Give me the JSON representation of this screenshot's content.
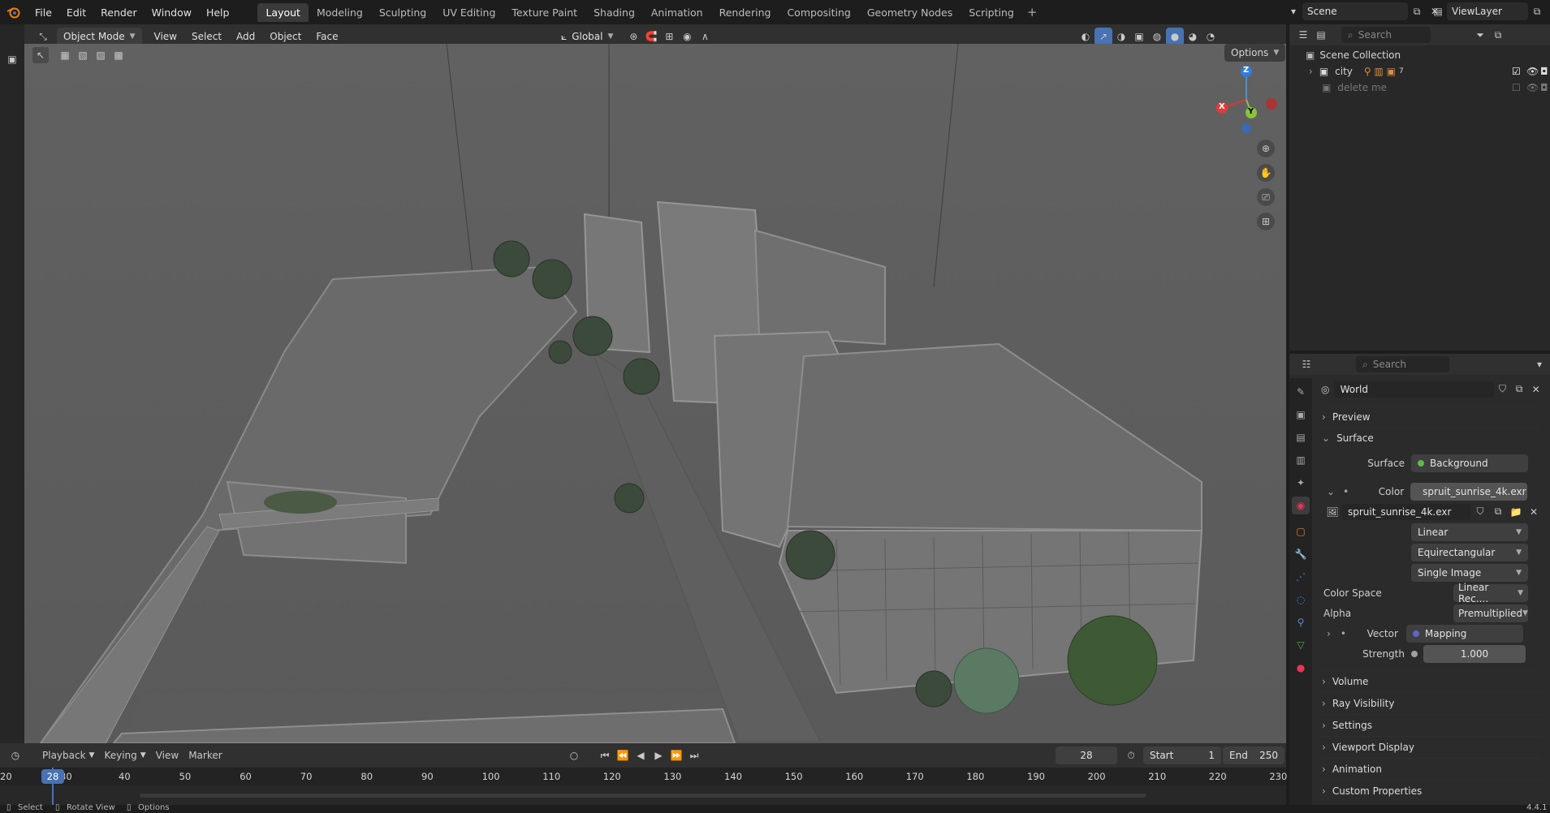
{
  "menubar": {
    "items": [
      "File",
      "Edit",
      "Render",
      "Window",
      "Help"
    ]
  },
  "workspace_tabs": [
    {
      "label": "Layout",
      "active": true
    },
    {
      "label": "Modeling"
    },
    {
      "label": "Sculpting"
    },
    {
      "label": "UV Editing"
    },
    {
      "label": "Texture Paint"
    },
    {
      "label": "Shading"
    },
    {
      "label": "Animation"
    },
    {
      "label": "Rendering"
    },
    {
      "label": "Compositing"
    },
    {
      "label": "Geometry Nodes"
    },
    {
      "label": "Scripting"
    }
  ],
  "add_tab": "+",
  "scene": {
    "name": "Scene",
    "view_layer": "ViewLayer"
  },
  "viewport_header": {
    "mode": "Object Mode",
    "menus": [
      "View",
      "Select",
      "Add",
      "Object",
      "Face"
    ],
    "transform_orientation": "Global",
    "options_label": "Options"
  },
  "gizmo": {
    "z": "Z",
    "x": "X",
    "y": "Y"
  },
  "outliner": {
    "search_placeholder": "Search",
    "title": "Scene Collection",
    "items": [
      {
        "label": "city",
        "badge": "7"
      },
      {
        "label": "delete me"
      }
    ]
  },
  "properties": {
    "search_placeholder": "Search",
    "world_name": "World",
    "sections_top": [
      "Preview",
      "Surface"
    ],
    "surface_label": "Surface",
    "surface_value": "Background",
    "color_label": "Color",
    "color_value": "spruit_sunrise_4k.exr",
    "image_name": "spruit_sunrise_4k.exr",
    "interpolation": "Linear",
    "projection": "Equirectangular",
    "source": "Single Image",
    "color_space_label": "Color Space",
    "color_space_value": "Linear Rec....",
    "alpha_label": "Alpha",
    "alpha_value": "Premultiplied",
    "vector_label": "Vector",
    "vector_value": "Mapping",
    "strength_label": "Strength",
    "strength_value": "1.000",
    "sections_bottom": [
      "Volume",
      "Ray Visibility",
      "Settings",
      "Viewport Display",
      "Animation",
      "Custom Properties"
    ],
    "colors": {
      "background_dot": "#5fb84b",
      "color_dot": "#e0c34d",
      "mapping_dot": "#6363c7",
      "strength_dot": "#a0a0a0"
    }
  },
  "timeline": {
    "menus": [
      "Playback",
      "Keying",
      "View",
      "Marker"
    ],
    "current_frame": "28",
    "start_label": "Start",
    "start_value": "1",
    "end_label": "End",
    "end_value": "250",
    "ruler_left": "20",
    "ticks": [
      "40",
      "50",
      "60",
      "70",
      "80",
      "90",
      "100",
      "110",
      "120",
      "130",
      "140",
      "150",
      "160",
      "170",
      "180",
      "190",
      "200",
      "210",
      "220",
      "230"
    ],
    "playhead": "28",
    "hidden_tick": "30"
  },
  "statusbar": {
    "items": [
      "Select",
      "Rotate View",
      "Options"
    ],
    "version": "4.4.1"
  }
}
